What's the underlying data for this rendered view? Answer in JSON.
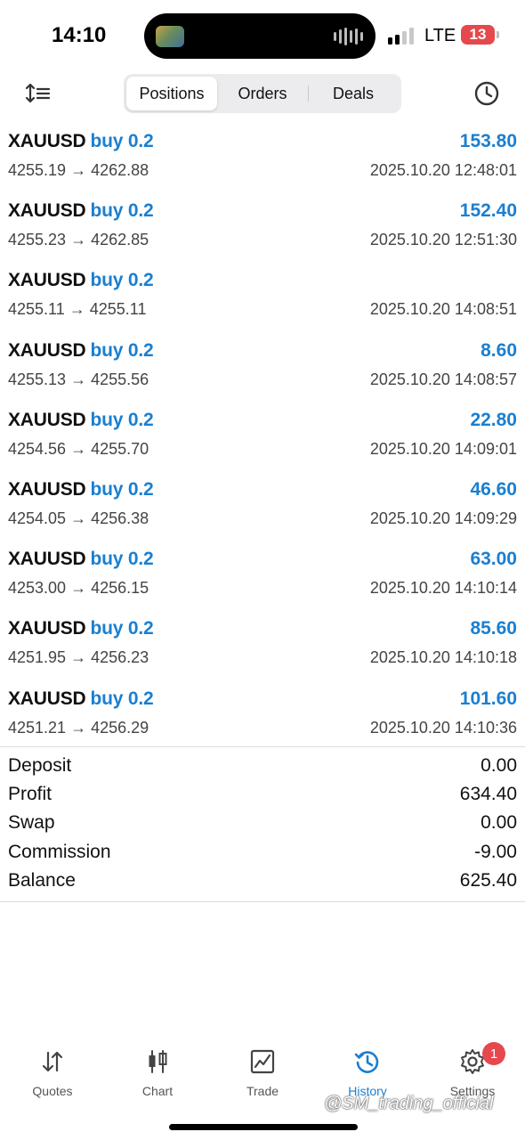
{
  "status_bar": {
    "time": "14:10",
    "network": "LTE",
    "battery": "13"
  },
  "toolbar": {
    "tabs": [
      {
        "label": "Positions",
        "active": true
      },
      {
        "label": "Orders",
        "active": false
      },
      {
        "label": "Deals",
        "active": false
      }
    ],
    "sort_icon": "sort-icon",
    "history_icon": "clock-icon"
  },
  "colors": {
    "accent": "#1a7fd1",
    "badge": "#e5484d"
  },
  "deals": [
    {
      "symbol": "XAUUSD",
      "side": "buy 0.2",
      "profit": "153.80",
      "prices": "4255.19 → 4262.88",
      "datetime": "2025.10.20 12:48:01"
    },
    {
      "symbol": "XAUUSD",
      "side": "buy 0.2",
      "profit": "152.40",
      "prices": "4255.23 → 4262.85",
      "datetime": "2025.10.20 12:51:30"
    },
    {
      "symbol": "XAUUSD",
      "side": "buy 0.2",
      "profit": "",
      "prices": "4255.11 → 4255.11",
      "datetime": "2025.10.20 14:08:51"
    },
    {
      "symbol": "XAUUSD",
      "side": "buy 0.2",
      "profit": "8.60",
      "prices": "4255.13 → 4255.56",
      "datetime": "2025.10.20 14:08:57"
    },
    {
      "symbol": "XAUUSD",
      "side": "buy 0.2",
      "profit": "22.80",
      "prices": "4254.56 → 4255.70",
      "datetime": "2025.10.20 14:09:01"
    },
    {
      "symbol": "XAUUSD",
      "side": "buy 0.2",
      "profit": "46.60",
      "prices": "4254.05 → 4256.38",
      "datetime": "2025.10.20 14:09:29"
    },
    {
      "symbol": "XAUUSD",
      "side": "buy 0.2",
      "profit": "63.00",
      "prices": "4253.00 → 4256.15",
      "datetime": "2025.10.20 14:10:14"
    },
    {
      "symbol": "XAUUSD",
      "side": "buy 0.2",
      "profit": "85.60",
      "prices": "4251.95 → 4256.23",
      "datetime": "2025.10.20 14:10:18"
    },
    {
      "symbol": "XAUUSD",
      "side": "buy 0.2",
      "profit": "101.60",
      "prices": "4251.21 → 4256.29",
      "datetime": "2025.10.20 14:10:36"
    }
  ],
  "summary": [
    {
      "label": "Deposit",
      "value": "0.00"
    },
    {
      "label": "Profit",
      "value": "634.40"
    },
    {
      "label": "Swap",
      "value": "0.00"
    },
    {
      "label": "Commission",
      "value": "-9.00"
    },
    {
      "label": "Balance",
      "value": "625.40"
    }
  ],
  "tabbar": [
    {
      "label": "Quotes",
      "icon": "quotes-arrows-icon",
      "active": false
    },
    {
      "label": "Chart",
      "icon": "candlestick-icon",
      "active": false
    },
    {
      "label": "Trade",
      "icon": "trade-chart-icon",
      "active": false
    },
    {
      "label": "History",
      "icon": "history-icon",
      "active": true
    },
    {
      "label": "Settings",
      "icon": "gear-icon",
      "active": false,
      "badge": "1"
    }
  ],
  "watermark": "@SM_trading_official"
}
